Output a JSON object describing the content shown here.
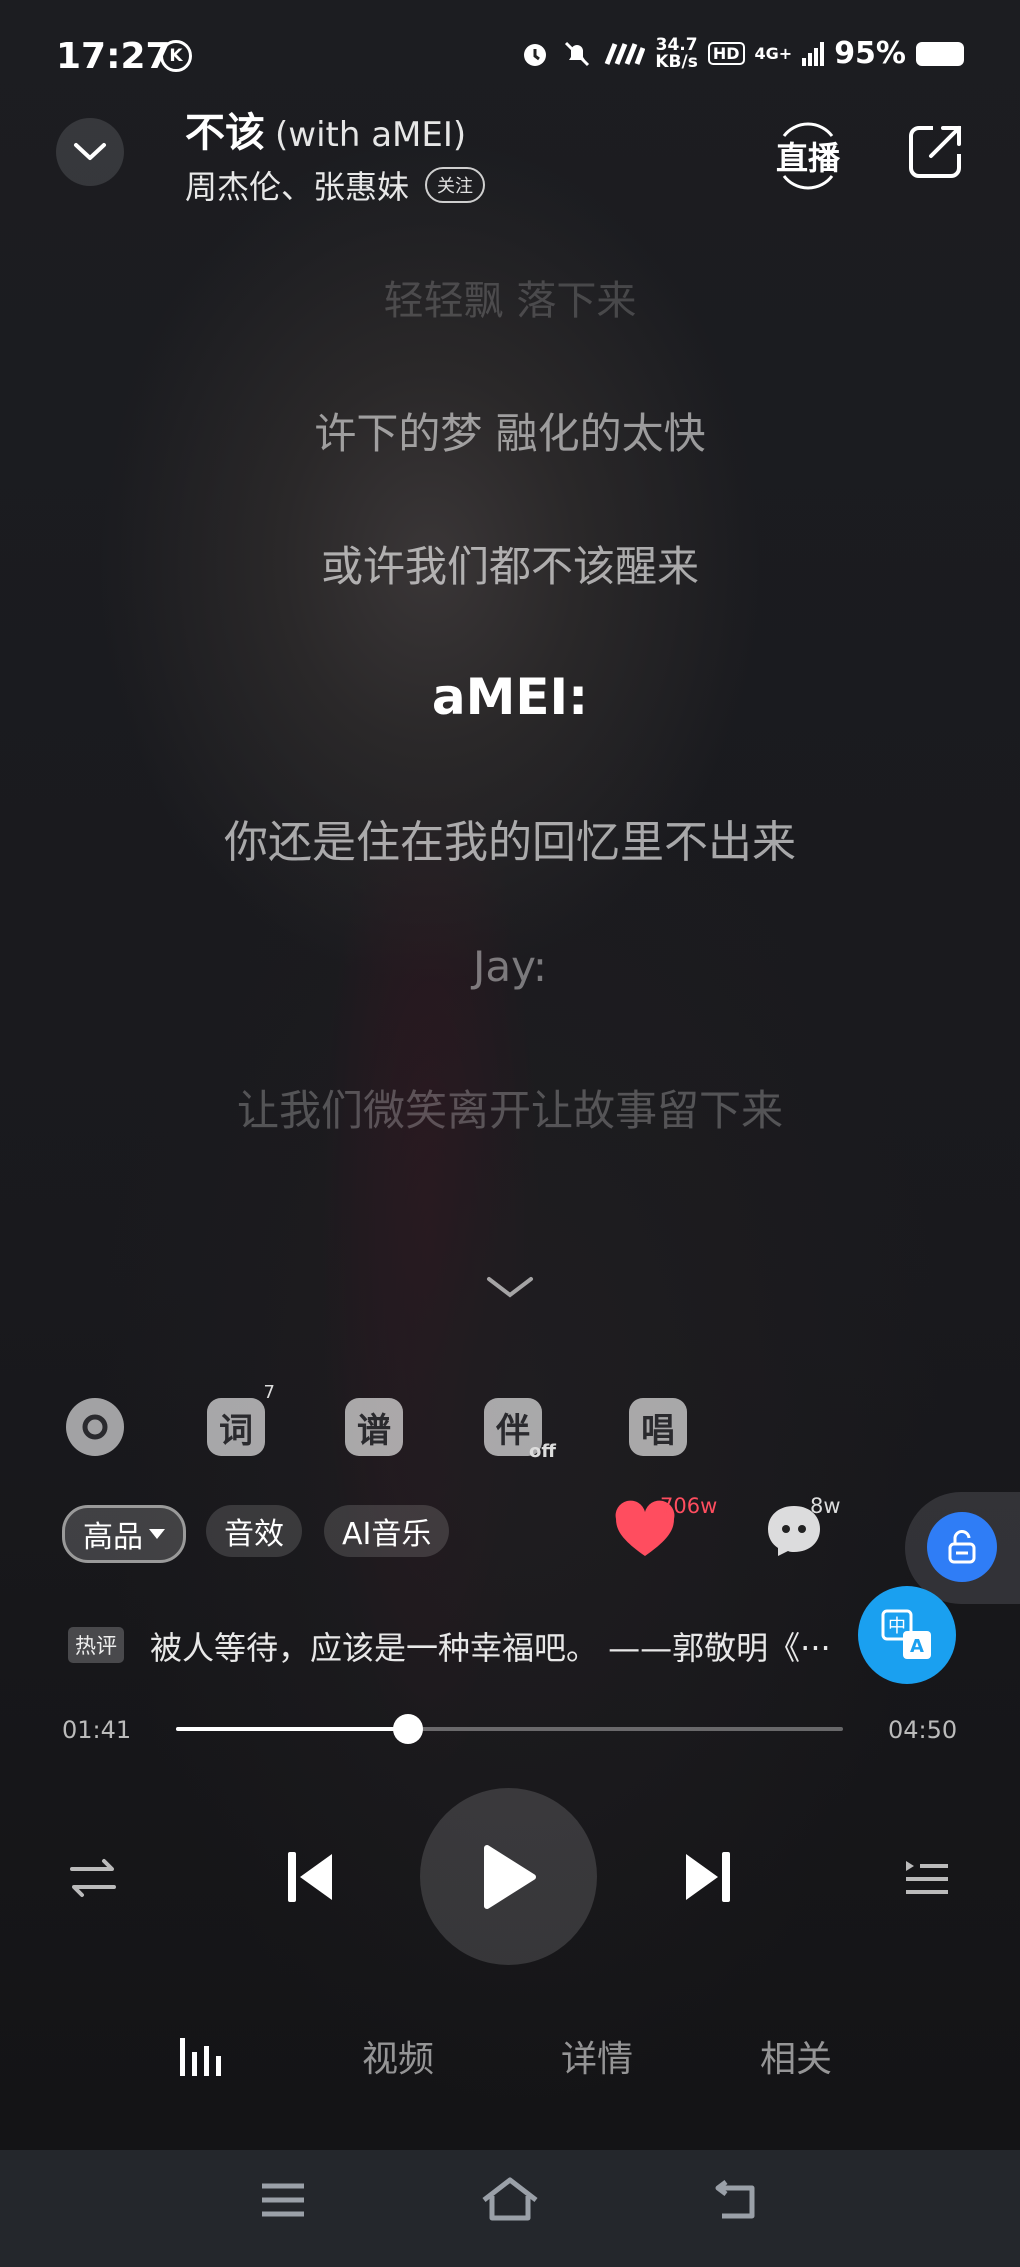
{
  "status_bar": {
    "time": "17:27",
    "net_speed_value": "34.7",
    "net_speed_unit": "KB/s",
    "hd": "HD",
    "network": "4G+",
    "battery": "95%"
  },
  "header": {
    "title": "不该",
    "title_suffix": "(with aMEI)",
    "artists": "周杰伦、张惠妹",
    "follow_label": "关注",
    "live_label": "直播"
  },
  "lyrics": [
    "轻轻飘 落下来",
    "许下的梦 融化的太快",
    "或许我们都不该醒来",
    "aMEI:",
    "你还是住在我的回忆里不出来",
    "Jay:",
    "让我们微笑离开让故事留下来"
  ],
  "tools": {
    "lyrics_label": "词",
    "lyrics_badge": "7",
    "score_label": "谱",
    "accompany_label": "伴",
    "accompany_state": "off",
    "sing_label": "唱"
  },
  "chips": {
    "quality": "高品",
    "effects": "音效",
    "ai_music": "AI音乐"
  },
  "counts": {
    "likes": "706w",
    "comments": "8w"
  },
  "hot_comment": {
    "tag": "热评",
    "text": "被人等待，应该是一种幸福吧。 ——郭敬明《···"
  },
  "progress": {
    "current": "01:41",
    "total": "04:50",
    "fraction": 0.348
  },
  "tabs": [
    "视频",
    "详情",
    "相关"
  ],
  "colors": {
    "accent_like": "#ff4d5f",
    "fab_blue": "#2f7df6",
    "translate_blue": "#1aa0f0"
  }
}
